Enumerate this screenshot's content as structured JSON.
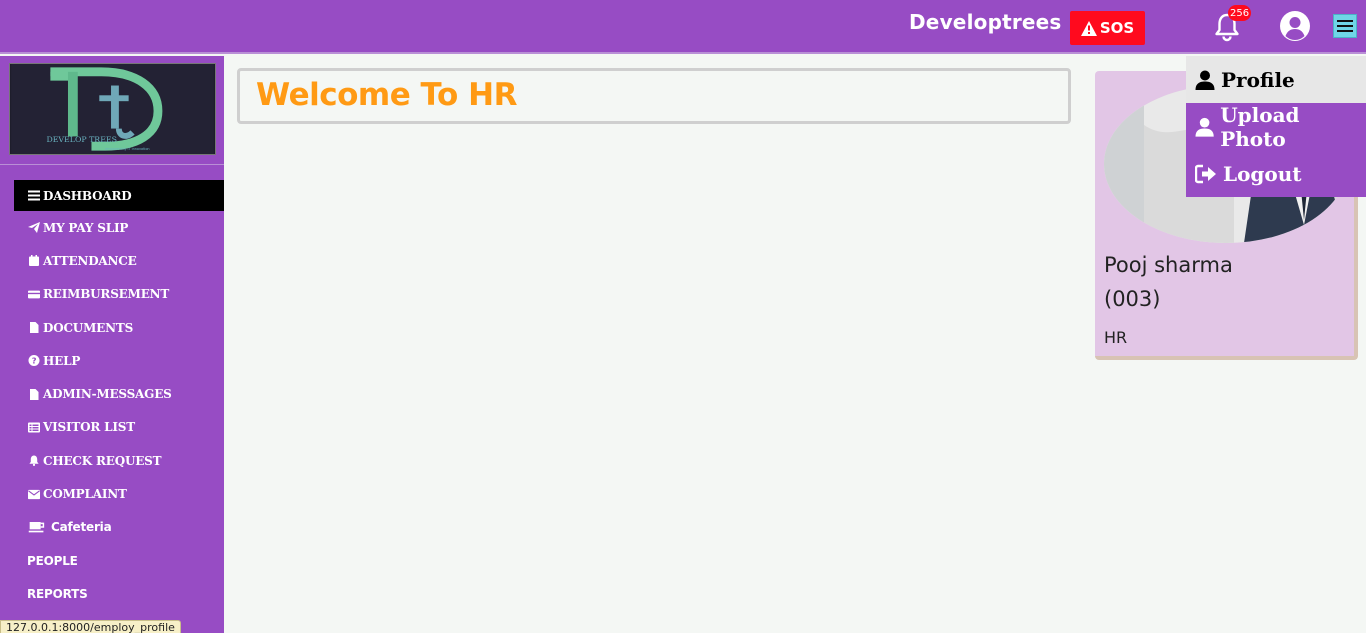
{
  "header": {
    "brand": "Developtrees",
    "sos_label": "SOS",
    "notification_count": "256"
  },
  "sidebar": {
    "logo_text": "DEVELOP TREES",
    "logo_tagline": "empowering IT innovation",
    "items": [
      {
        "label": "DASHBOARD",
        "icon": "bars-icon"
      },
      {
        "label": "MY PAY SLIP",
        "icon": "paper-plane-icon"
      },
      {
        "label": "ATTENDANCE",
        "icon": "calendar-icon"
      },
      {
        "label": "REIMBURSEMENT",
        "icon": "credit-card-icon"
      },
      {
        "label": "DOCUMENTS",
        "icon": "file-icon"
      },
      {
        "label": "HELP",
        "icon": "question-circle-icon"
      },
      {
        "label": "ADMIN-MESSAGES",
        "icon": "file-icon"
      },
      {
        "label": "VISITOR LIST",
        "icon": "list-icon"
      },
      {
        "label": "CHECK REQUEST",
        "icon": "bell-icon"
      },
      {
        "label": "COMPLAINT",
        "icon": "envelope-icon"
      },
      {
        "label": "Cafeteria",
        "icon": "coffee-icon"
      },
      {
        "label": "PEOPLE",
        "icon": ""
      },
      {
        "label": "REPORTS",
        "icon": ""
      }
    ]
  },
  "main": {
    "welcome_title": "Welcome To HR"
  },
  "profile_card": {
    "name": "Pooj sharma",
    "employee_id": "(003)",
    "role": "HR"
  },
  "user_menu": {
    "items": [
      {
        "label": "Profile",
        "icon": "user-icon"
      },
      {
        "label": "Upload Photo",
        "icon": "user-icon"
      },
      {
        "label": "Logout",
        "icon": "sign-out-icon"
      }
    ]
  },
  "status_bar": {
    "url": "127.0.0.1:8000/employ_profile"
  },
  "colors": {
    "primary": "#974cc4",
    "accent": "#ff9a14",
    "sos": "#ff0a1e",
    "card": "#e2c6e6"
  }
}
